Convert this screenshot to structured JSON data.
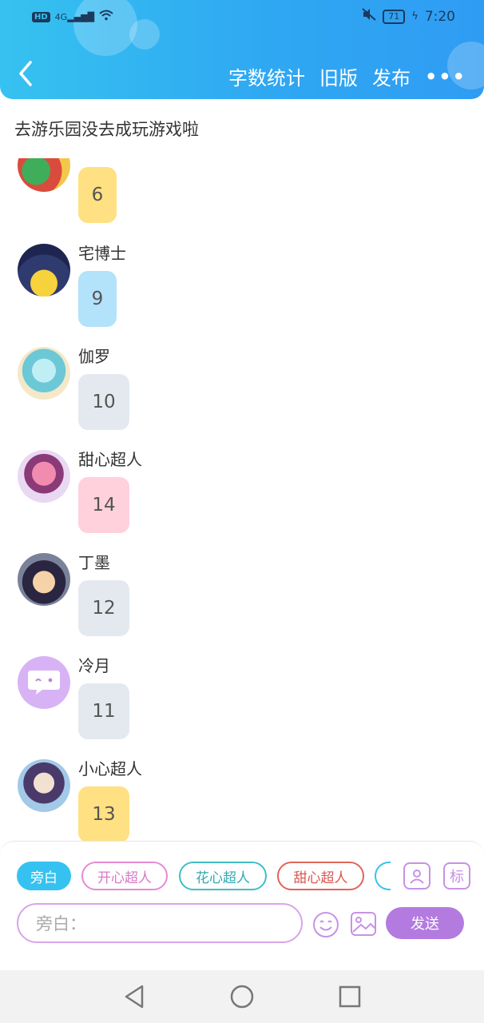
{
  "status_bar": {
    "network_badge": "HD",
    "signal": "4G",
    "battery": "71",
    "time": "7:20"
  },
  "header": {
    "actions": [
      "字数统计",
      "旧版",
      "发布"
    ],
    "more": "•••"
  },
  "story_title": "去游乐园没去成玩游戏啦",
  "messages": [
    {
      "name": "",
      "text": "6",
      "bubble_color": "#ffe082"
    },
    {
      "name": "宅博士",
      "text": "9",
      "bubble_color": "#b3e2fb"
    },
    {
      "name": "伽罗",
      "text": "10",
      "bubble_color": "#e4e9f0"
    },
    {
      "name": "甜心超人",
      "text": "14",
      "bubble_color": "#ffd1dc"
    },
    {
      "name": "丁墨",
      "text": "12",
      "bubble_color": "#e4e9f0"
    },
    {
      "name": "冷月",
      "text": "11",
      "bubble_color": "#e4e9f0"
    },
    {
      "name": "小心超人",
      "text": "13",
      "bubble_color": "#ffe082"
    }
  ],
  "composer": {
    "roles": [
      {
        "label": "旁白",
        "color": "#36c2f0"
      },
      {
        "label": "开心超人",
        "color": "#e58ad6"
      },
      {
        "label": "花心超人",
        "color": "#3fbfc7"
      },
      {
        "label": "甜心超人",
        "color": "#e0645a"
      }
    ],
    "input_placeholder": "旁白：",
    "send_label": "发送",
    "tag_label": "标"
  }
}
